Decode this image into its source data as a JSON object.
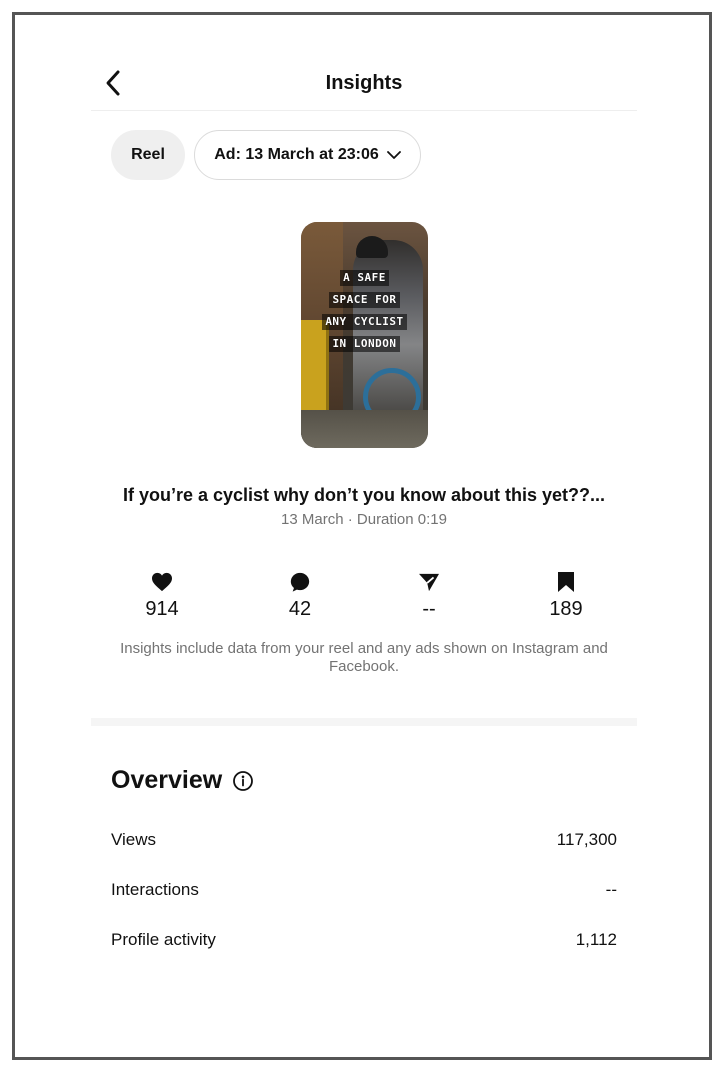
{
  "header": {
    "title": "Insights",
    "back_icon": "chevron-left-icon"
  },
  "filters": {
    "type_label": "Reel",
    "ad_label": "Ad: 13 March at 23:06",
    "ad_icon": "chevron-down-icon"
  },
  "thumbnail": {
    "overlay_lines": [
      "A SAFE",
      "SPACE FOR",
      "ANY CYCLIST",
      "IN LONDON"
    ]
  },
  "post": {
    "caption": "If you’re a cyclist why don’t you know about this yet??...",
    "meta": "13 March · Duration 0:19"
  },
  "stats": {
    "likes": {
      "icon": "heart-icon",
      "value": "914"
    },
    "comments": {
      "icon": "comment-icon",
      "value": "42"
    },
    "shares": {
      "icon": "send-icon",
      "value": "--"
    },
    "saves": {
      "icon": "bookmark-icon",
      "value": "189"
    }
  },
  "note": "Insights include data from your reel and any ads shown on Instagram and Facebook.",
  "overview": {
    "title": "Overview",
    "info_icon": "info-icon",
    "rows": [
      {
        "label": "Views",
        "value": "117,300"
      },
      {
        "label": "Interactions",
        "value": "--"
      },
      {
        "label": "Profile activity",
        "value": "1,112"
      }
    ]
  },
  "colors": {
    "text": "#111111",
    "secondary": "#737373",
    "chip_bg": "#efefef",
    "border": "#dbdbdb"
  }
}
